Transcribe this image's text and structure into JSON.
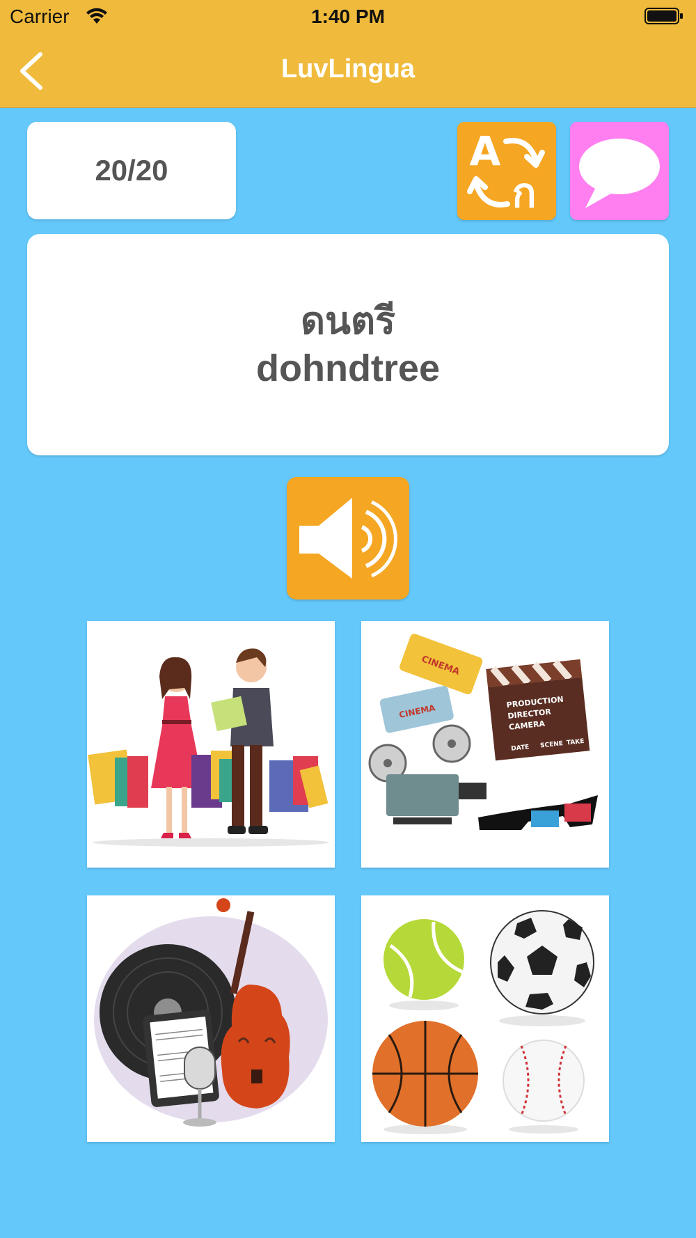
{
  "status_bar": {
    "carrier": "Carrier",
    "time": "1:40 PM"
  },
  "nav": {
    "title": "LuvLingua"
  },
  "quiz": {
    "progress": "20/20",
    "word_native": "ดนตรี",
    "word_romanized": "dohndtree"
  },
  "translate_button": {
    "glyph_latin": "A",
    "glyph_thai": "ก"
  },
  "choices": [
    {
      "icon": "shopping-illustration"
    },
    {
      "icon": "movies-illustration",
      "ticket_text": "CINEMA",
      "ticket_text_2": "CINEMA",
      "clapper_line_1": "PRODUCTION",
      "clapper_line_2": "DIRECTOR",
      "clapper_line_3": "CAMERA",
      "clapper_date": "DATE",
      "clapper_scene": "SCENE",
      "clapper_take": "TAKE"
    },
    {
      "icon": "music-illustration"
    },
    {
      "icon": "sports-balls-illustration"
    }
  ],
  "colors": {
    "background": "#64c8fa",
    "bar": "#f0bb3c",
    "orange_button": "#f5a623",
    "pink_button": "#ff7ff0"
  }
}
